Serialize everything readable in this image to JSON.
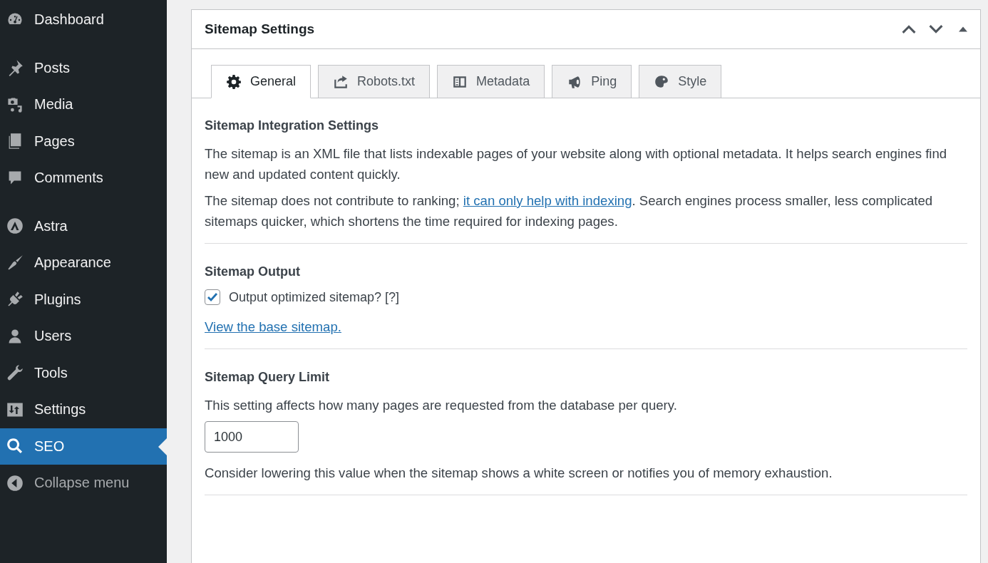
{
  "sidebar": {
    "groups": [
      {
        "items": [
          {
            "label": "Dashboard",
            "selected": false
          }
        ]
      },
      {
        "items": [
          {
            "label": "Posts",
            "selected": false
          },
          {
            "label": "Media",
            "selected": false
          },
          {
            "label": "Pages",
            "selected": false
          },
          {
            "label": "Comments",
            "selected": false
          }
        ]
      },
      {
        "items": [
          {
            "label": "Astra",
            "selected": false
          },
          {
            "label": "Appearance",
            "selected": false
          },
          {
            "label": "Plugins",
            "selected": false
          },
          {
            "label": "Users",
            "selected": false
          },
          {
            "label": "Tools",
            "selected": false
          },
          {
            "label": "Settings",
            "selected": false
          },
          {
            "label": "SEO",
            "selected": true
          }
        ]
      }
    ],
    "collapse_label": "Collapse menu"
  },
  "panel": {
    "title": "Sitemap Settings",
    "tabs": [
      {
        "label": "General",
        "selected": true
      },
      {
        "label": "Robots.txt",
        "selected": false
      },
      {
        "label": "Metadata",
        "selected": false
      },
      {
        "label": "Ping",
        "selected": false
      },
      {
        "label": "Style",
        "selected": false
      }
    ],
    "sections": [
      {
        "heading": "Sitemap Integration Settings",
        "blocks": [
          {
            "kind": "paragraph",
            "text": "The sitemap is an XML file that lists indexable pages of your website along with optional metadata. It helps search engines find new and updated content quickly."
          },
          {
            "kind": "linked_paragraph",
            "before": "The sitemap does not contribute to ranking; ",
            "link": "it can only help with indexing",
            "after": ". Search engines process smaller, less complicated sitemaps quicker, which shortens the time required for indexing pages."
          }
        ]
      },
      {
        "heading": "Sitemap Output",
        "blocks": [
          {
            "kind": "checkbox",
            "label": "Output optimized sitemap? [?]",
            "checked": true
          },
          {
            "kind": "link",
            "text": "View the base sitemap."
          }
        ]
      },
      {
        "heading": "Sitemap Query Limit",
        "blocks": [
          {
            "kind": "paragraph",
            "text": "This setting affects how many pages are requested from the database per query."
          },
          {
            "kind": "input",
            "value": "1000"
          },
          {
            "kind": "paragraph",
            "text": "Consider lowering this value when the sitemap shows a white screen or notifies you of memory exhaustion."
          }
        ]
      }
    ]
  }
}
